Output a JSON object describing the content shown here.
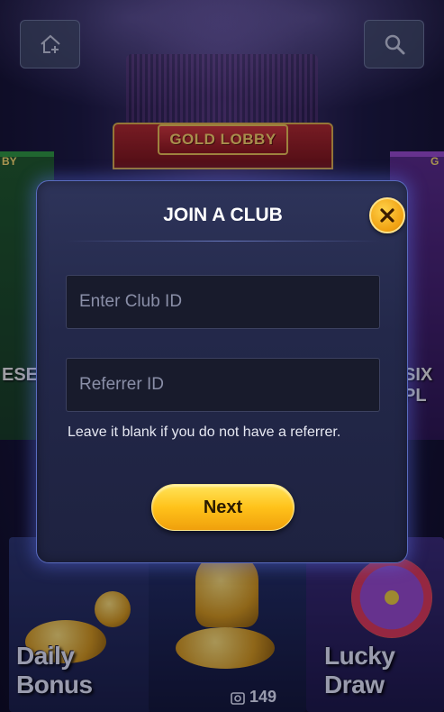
{
  "top_bar": {
    "add_home_icon": "add-home-icon",
    "search_icon": "search-icon"
  },
  "lobby": {
    "banner_title": "GOLD LOBBY",
    "left_tag": "BY",
    "right_tag": "G",
    "left_card_label": "ESE PO",
    "right_card_label": "SIX PL"
  },
  "bottom_tiles": {
    "daily_bonus_label": "Daily Bonus",
    "center_count": "149",
    "lucky_draw_label": "Lucky Draw"
  },
  "modal": {
    "title": "JOIN A CLUB",
    "club_id_placeholder": "Enter Club ID",
    "referrer_placeholder": "Referrer ID",
    "hint": "Leave it blank if you do not have a referrer.",
    "next_label": "Next"
  },
  "colors": {
    "accent_gold": "#ffc21a",
    "modal_border": "#5a6cc0",
    "background": "#1b1840"
  }
}
